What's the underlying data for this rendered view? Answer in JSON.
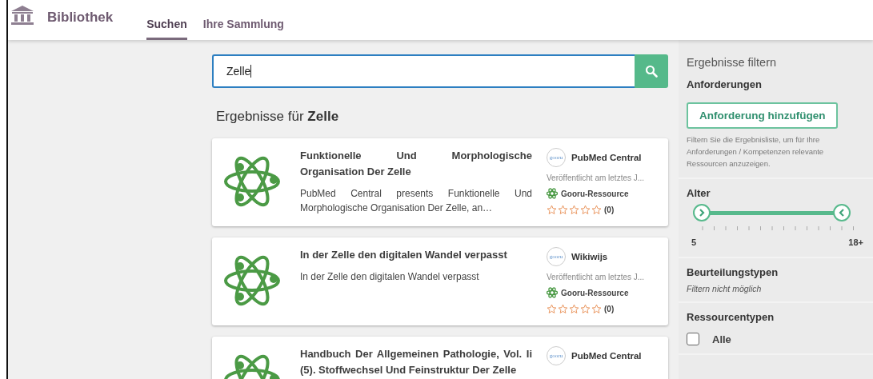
{
  "header": {
    "brand": "Bibliothek",
    "tabs": [
      {
        "label": "Suchen",
        "selected": true
      },
      {
        "label": "Ihre Sammlung",
        "selected": false
      }
    ]
  },
  "search": {
    "value": "Zelle"
  },
  "results_heading": "Ergebnisse für **Zelle**",
  "results": [
    {
      "title": "Funktionelle Und Morphologische Organisation Der Zelle",
      "description": "PubMed Central presents Funktionelle Und Morphologische Organisation Der Zelle, an…",
      "logo_text": "gooru",
      "source": "PubMed Central",
      "published": "Veröffentlicht am letztes J...",
      "resource_type": "Gooru-Ressource",
      "stars": 0,
      "rating_count": "(0)"
    },
    {
      "title": "In der Zelle den digitalen Wandel verpasst",
      "description": "In der Zelle den digitalen Wandel verpasst",
      "logo_text": "gooru",
      "source": "Wikiwijs",
      "published": "Veröffentlicht am letztes J...",
      "resource_type": "Gooru-Ressource",
      "stars": 0,
      "rating_count": "(0)"
    },
    {
      "title": "Handbuch Der Allgemeinen Pathologie, Vol. Ii (5). Stoffwechsel Und Feinstruktur Der Zelle",
      "logo_text": "gooru",
      "source": "PubMed Central"
    }
  ],
  "filters": {
    "title": "Ergebnisse filtern",
    "requirements": {
      "heading": "Anforderungen",
      "button": "Anforderung hinzufügen",
      "hint": "Filtern Sie die Ergebnisliste, um für Ihre Anforderungen / Kompetenzen relevante Ressourcen anzuzeigen."
    },
    "age": {
      "heading": "Alter",
      "thumbs": [
        {
          "level": 0
        },
        {
          "level": 1
        }
      ],
      "min_label": "5",
      "max_label": "18+"
    },
    "assessment_types": {
      "heading": "Beurteilungstypen",
      "note": "Filtern nicht möglich"
    },
    "resource_types": {
      "heading": "Ressourcentypen",
      "options": [
        {
          "label": "Alle",
          "checked": false
        }
      ]
    }
  }
}
